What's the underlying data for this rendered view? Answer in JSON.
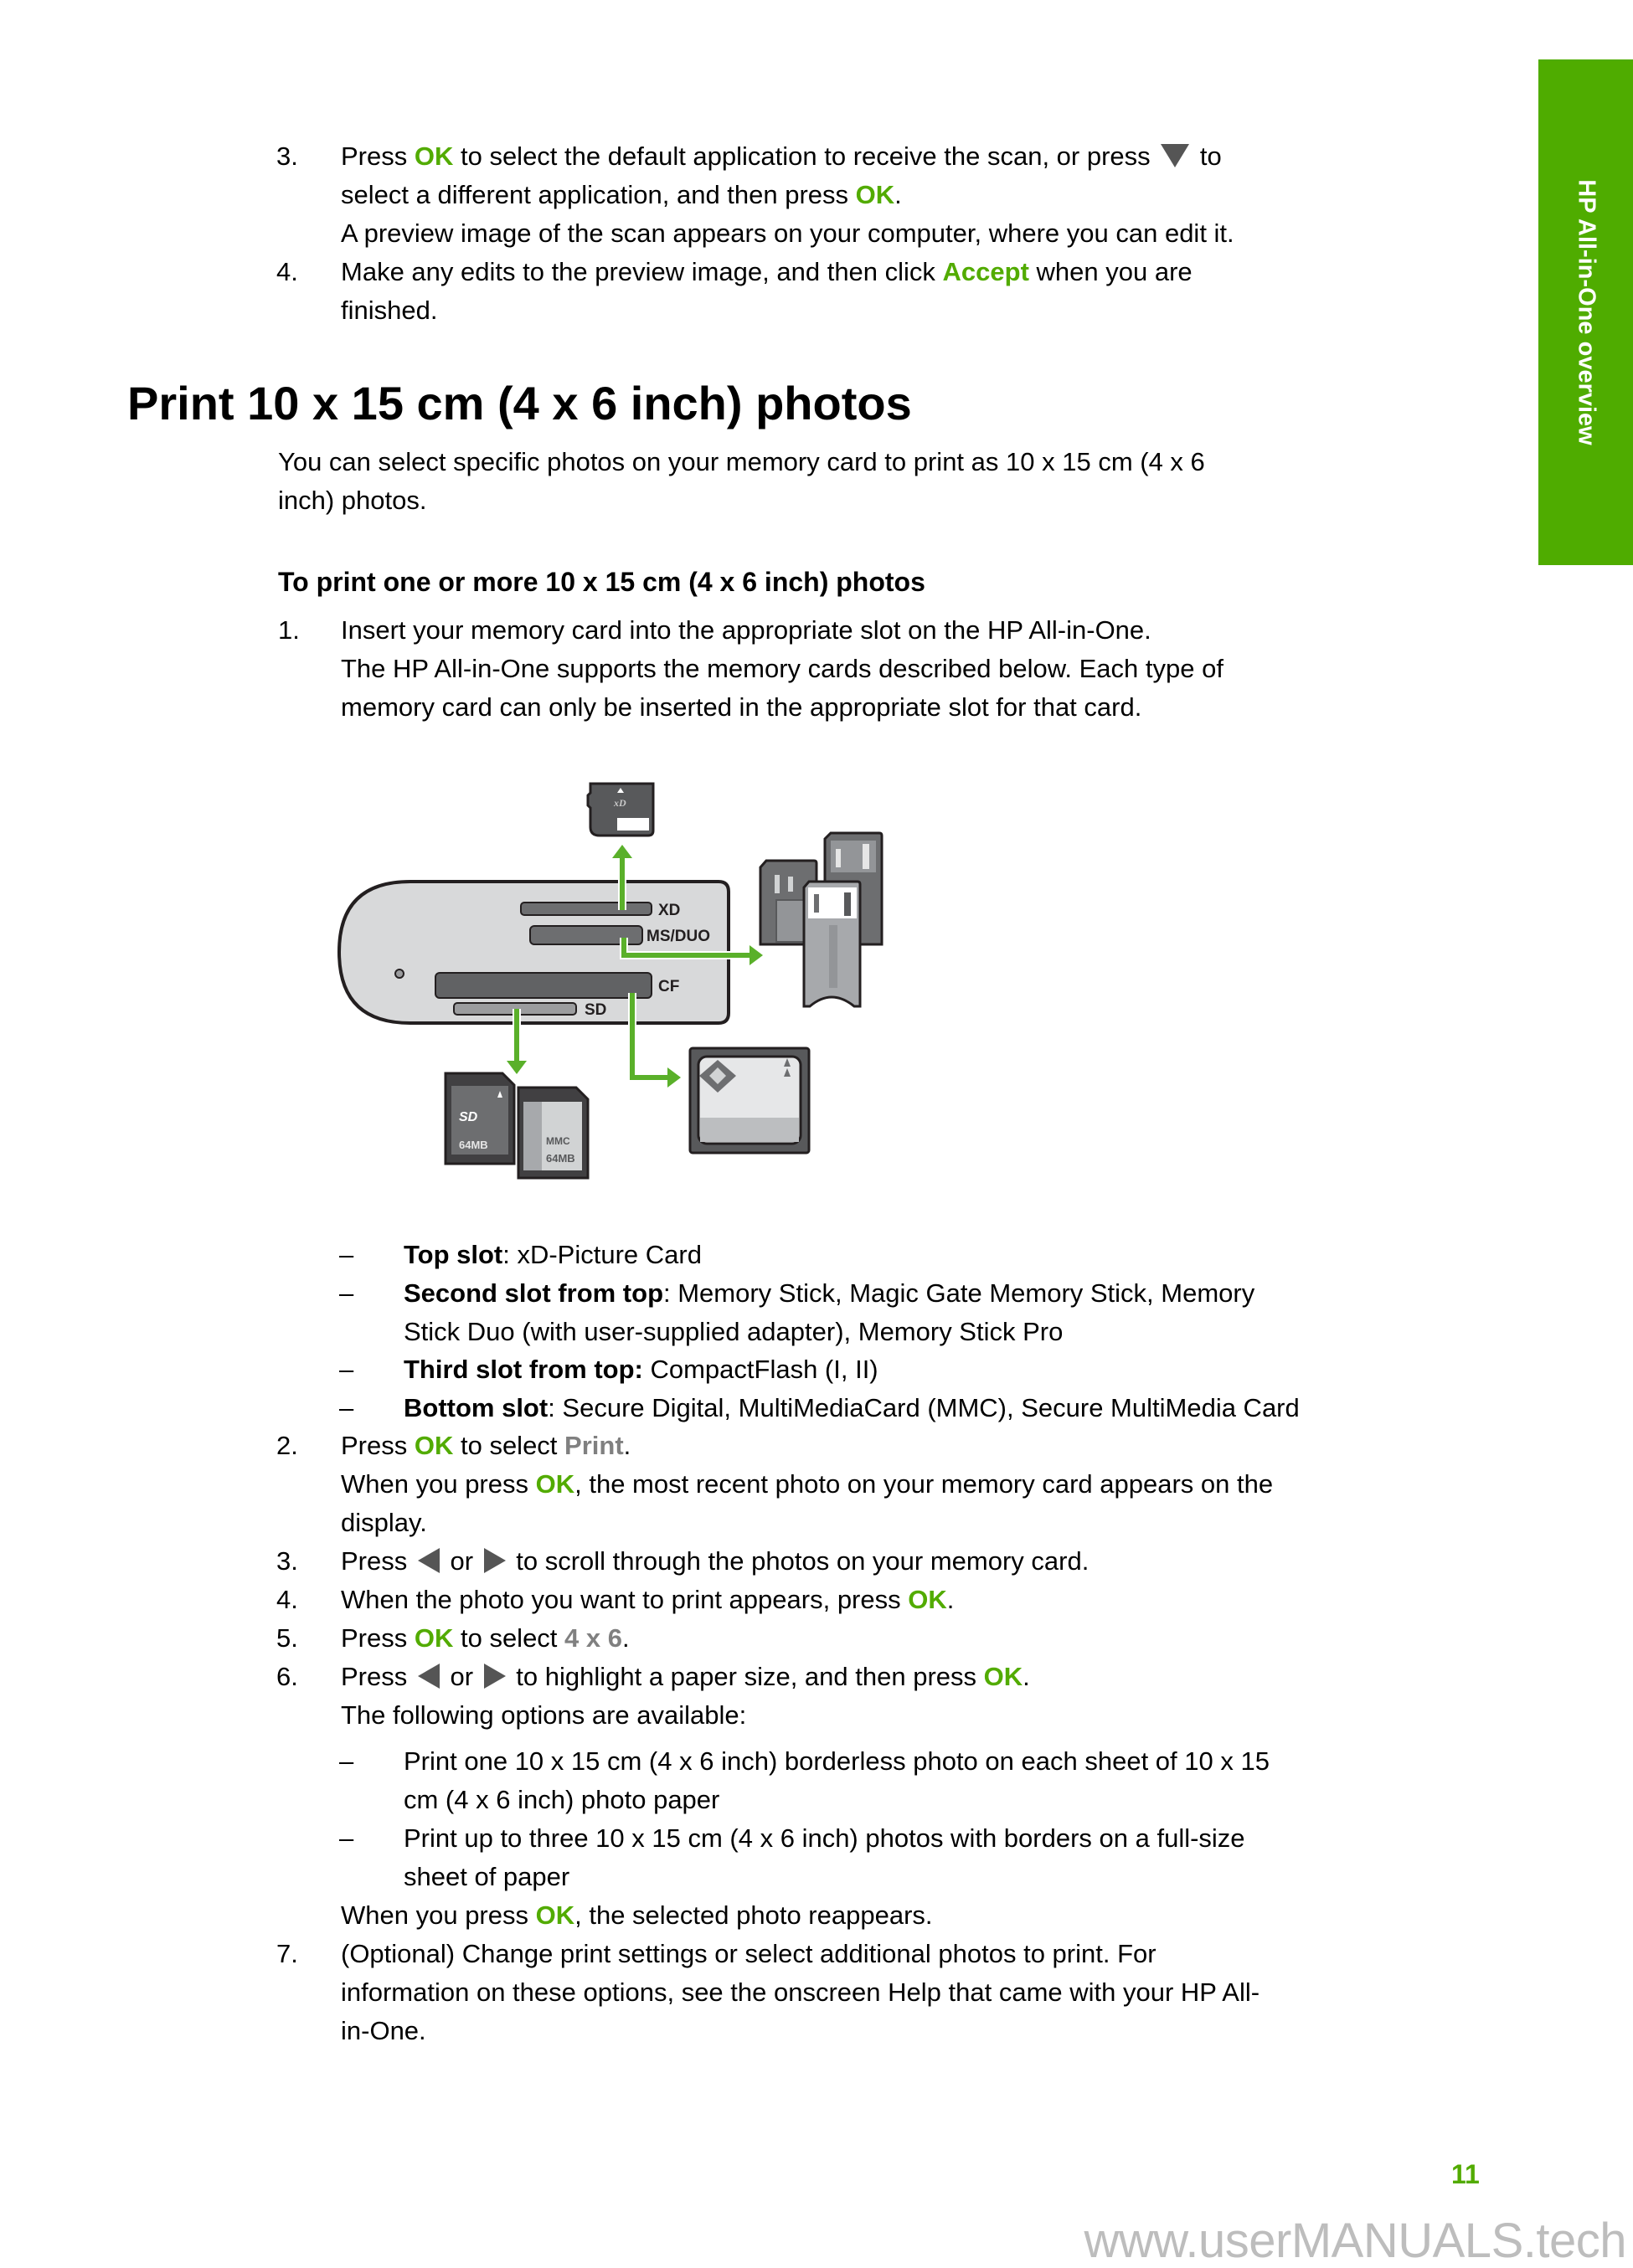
{
  "sidebar_tab": {
    "label": "HP All-in-One overview",
    "color": "#4fac00"
  },
  "top_steps": [
    {
      "number": "3.",
      "lines": [
        [
          {
            "t": "Press "
          },
          {
            "t": "OK",
            "style": "ok"
          },
          {
            "t": " to select the default application to receive the scan, or press "
          },
          {
            "icon": "down-arrow-icon"
          },
          {
            "t": " to"
          }
        ],
        [
          {
            "t": "select a different application, and then press "
          },
          {
            "t": "OK",
            "style": "ok"
          },
          {
            "t": "."
          }
        ],
        [
          {
            "t": "A preview image of the scan appears on your computer, where you can edit it."
          }
        ]
      ]
    },
    {
      "number": "4.",
      "lines": [
        [
          {
            "t": "Make any edits to the preview image, and then click "
          },
          {
            "t": "Accept",
            "style": "ok"
          },
          {
            "t": " when you are"
          }
        ],
        [
          {
            "t": "finished."
          }
        ]
      ]
    }
  ],
  "section": {
    "heading": "Print 10 x 15 cm (4 x 6 inch) photos",
    "intro_lines": [
      "You can select specific photos on your memory card to print as 10 x 15 cm (4 x 6",
      "inch) photos."
    ],
    "procedure_title": "To print one or more 10 x 15 cm (4 x 6 inch) photos"
  },
  "step1": {
    "number": "1.",
    "lines": [
      "Insert your memory card into the appropriate slot on the HP All-in-One.",
      "The HP All-in-One supports the memory cards described below. Each type of",
      "memory card can only be inserted in the appropriate slot for that card."
    ]
  },
  "diagram": {
    "slot_labels": [
      "XD",
      "MS/DUO",
      "CF",
      "SD"
    ],
    "card_labels": {
      "xd": "xD",
      "sd": "SD",
      "sd_capacity": "64MB",
      "mmc": "MMC",
      "mmc_capacity": "64MB"
    },
    "arrow_color": "#5ab02a"
  },
  "slot_list": [
    {
      "label": "Top slot",
      "colon_bold": false,
      "text": ": xD-Picture Card"
    },
    {
      "label": "Second slot from top",
      "colon_bold": false,
      "text": ": Memory Stick, Magic Gate Memory Stick, Memory",
      "cont": "Stick Duo (with user-supplied adapter), Memory Stick Pro"
    },
    {
      "label": "Third slot from top:",
      "colon_bold": true,
      "text": " CompactFlash (I, II)"
    },
    {
      "label": "Bottom slot",
      "colon_bold": false,
      "text": ": Secure Digital, MultiMediaCard (MMC), Secure MultiMedia Card"
    }
  ],
  "dash": "–",
  "steps": {
    "s2": {
      "number": "2.",
      "a": "Press ",
      "ok": "OK",
      "b": " to select ",
      "menu": "Print",
      "c": ".",
      "l2a": "When you press ",
      "l2b": ", the most recent photo on your memory card appears on the",
      "l3": "display."
    },
    "s3": {
      "number": "3.",
      "a": "Press ",
      "or": " or ",
      "b": " to scroll through the photos on your memory card."
    },
    "s4": {
      "number": "4.",
      "a": "When the photo you want to print appears, press ",
      "ok": "OK",
      "b": "."
    },
    "s5": {
      "number": "5.",
      "a": "Press ",
      "ok": "OK",
      "b": " to select ",
      "menu": "4 x 6",
      "c": "."
    },
    "s6": {
      "number": "6.",
      "a": "Press ",
      "or": " or ",
      "b": " to highlight a paper size, and then press ",
      "ok": "OK",
      "c": ".",
      "l2": "The following options are available:",
      "options": [
        [
          "Print one 10 x 15 cm (4 x 6 inch) borderless photo on each sheet of 10 x 15",
          "cm (4 x 6 inch) photo paper"
        ],
        [
          "Print up to three 10 x 15 cm (4 x 6 inch) photos with borders on a full-size",
          "sheet of paper"
        ]
      ],
      "after_a": "When you press ",
      "after_ok": "OK",
      "after_b": ", the selected photo reappears."
    },
    "s7": {
      "number": "7.",
      "lines": [
        "(Optional) Change print settings or select additional photos to print. For",
        "information on these options, see the onscreen Help that came with your HP All-",
        "in-One."
      ]
    }
  },
  "footer": {
    "page_number": "11",
    "watermark": "www.userMANUALS.tech"
  }
}
